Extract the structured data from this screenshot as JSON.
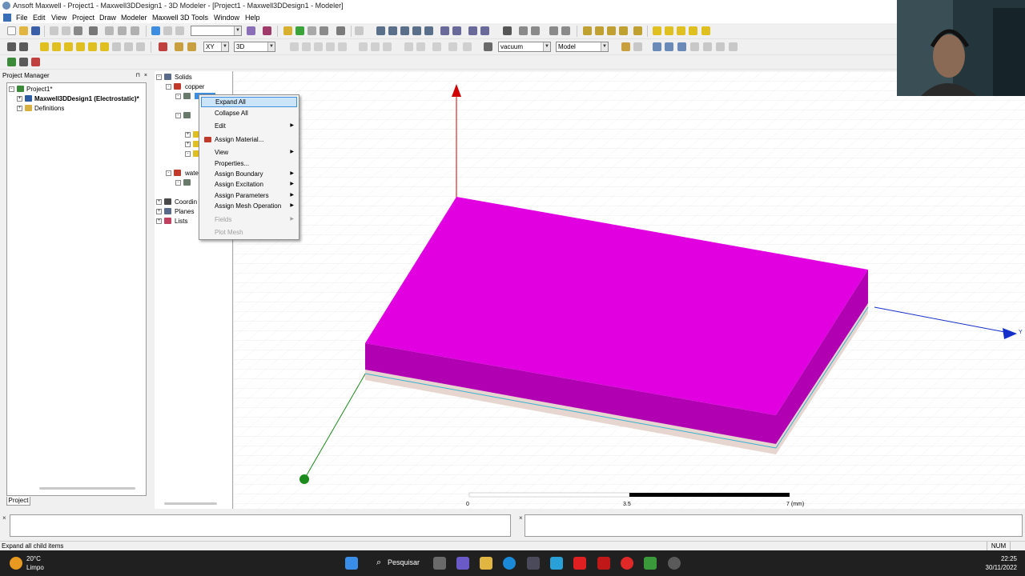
{
  "window": {
    "title": "Ansoft Maxwell - Project1 - Maxwell3DDesign1 - 3D Modeler - [Project1 - Maxwell3DDesign1 - Modeler]"
  },
  "menubar": {
    "items": [
      "File",
      "Edit",
      "View",
      "Project",
      "Draw",
      "Modeler",
      "Maxwell 3D",
      "Tools",
      "Window",
      "Help"
    ]
  },
  "toolbar": {
    "plane_select": "XY",
    "dim_select": "3D",
    "material_select": "vacuum",
    "model_select": "Model"
  },
  "project_manager": {
    "title": "Project Manager",
    "tree": {
      "project": "Project1*",
      "design": "Maxwell3DDesign1 (Electrostatic)*",
      "definitions": "Definitions"
    },
    "tab_label": "Project"
  },
  "model_tree": {
    "solids_label": "Solids",
    "copper_label": "copper",
    "water_label": "wate",
    "coordinate_label": "Coordin",
    "planes_label": "Planes",
    "lists_label": "Lists"
  },
  "context_menu": {
    "items": [
      {
        "label": "Expand All",
        "state": "highlighted",
        "submenu": false
      },
      {
        "label": "Collapse All",
        "state": "normal",
        "submenu": false
      },
      {
        "label": "Edit",
        "state": "normal",
        "submenu": true
      },
      {
        "label": "Assign Material...",
        "state": "normal",
        "submenu": false
      },
      {
        "label": "View",
        "state": "normal",
        "submenu": true
      },
      {
        "label": "Properties...",
        "state": "normal",
        "submenu": false
      },
      {
        "label": "Assign Boundary",
        "state": "normal",
        "submenu": true
      },
      {
        "label": "Assign Excitation",
        "state": "normal",
        "submenu": true
      },
      {
        "label": "Assign Parameters",
        "state": "normal",
        "submenu": true
      },
      {
        "label": "Assign Mesh Operation",
        "state": "normal",
        "submenu": true
      },
      {
        "label": "Fields",
        "state": "disabled",
        "submenu": true
      },
      {
        "label": "Plot Mesh",
        "state": "disabled",
        "submenu": false
      }
    ]
  },
  "viewport": {
    "scale_labels": [
      "0",
      "3.5",
      "7 (mm)"
    ],
    "axis_y_label": "Y",
    "colors": {
      "box_top": "#e000e0",
      "box_side": "#b100b1",
      "substrate": "#e6d6cf",
      "axis_x": "#d00000",
      "axis_y": "#1530c8",
      "axis_z": "#1a8a1a"
    }
  },
  "status": {
    "text": "Expand all child items",
    "num_indicator": "NUM"
  },
  "taskbar": {
    "temperature": "20°C",
    "weather": "Limpo",
    "search_label": "Pesquisar",
    "time": "22:25",
    "date": "30/11/2022"
  }
}
